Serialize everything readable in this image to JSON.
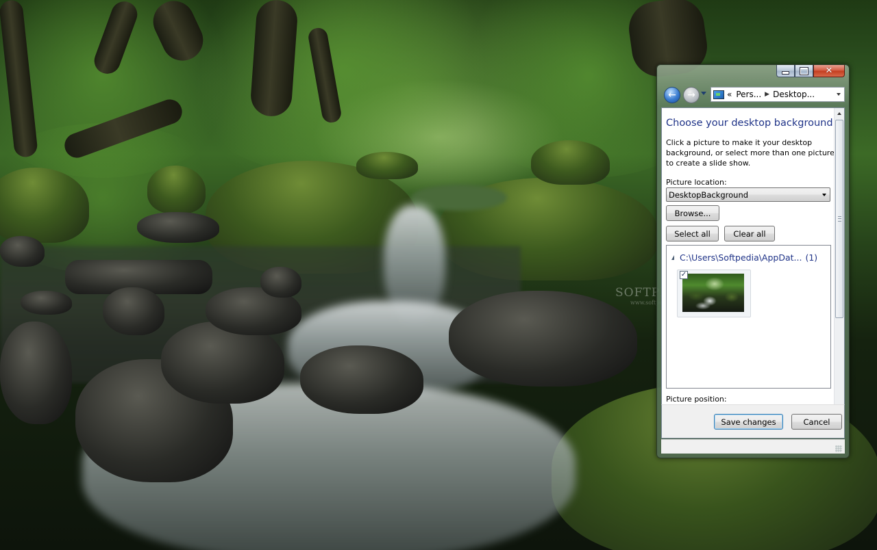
{
  "window": {
    "nav": {
      "breadcrumb": [
        "Pers...",
        "Desktop..."
      ],
      "overflow_label": "«"
    },
    "title": "Choose your desktop background",
    "description": "Click a picture to make it your desktop background, or select more than one picture to create a slide show.",
    "picture_location_label": "Picture location:",
    "picture_location_value": "DesktopBackground",
    "browse_label": "Browse...",
    "select_all_label": "Select all",
    "clear_all_label": "Clear all",
    "group": {
      "path": "C:\\Users\\Softpedia\\AppDat...",
      "count": "(1)",
      "items": [
        {
          "checked": true
        }
      ]
    },
    "picture_position_label": "Picture position:",
    "save_label": "Save changes",
    "cancel_label": "Cancel"
  },
  "desktop": {
    "watermark": "SOFTPEDIA",
    "watermark_url": "www.softpedia.com"
  },
  "colors": {
    "heading": "#1e3287",
    "close_button": "#c23c1e"
  }
}
